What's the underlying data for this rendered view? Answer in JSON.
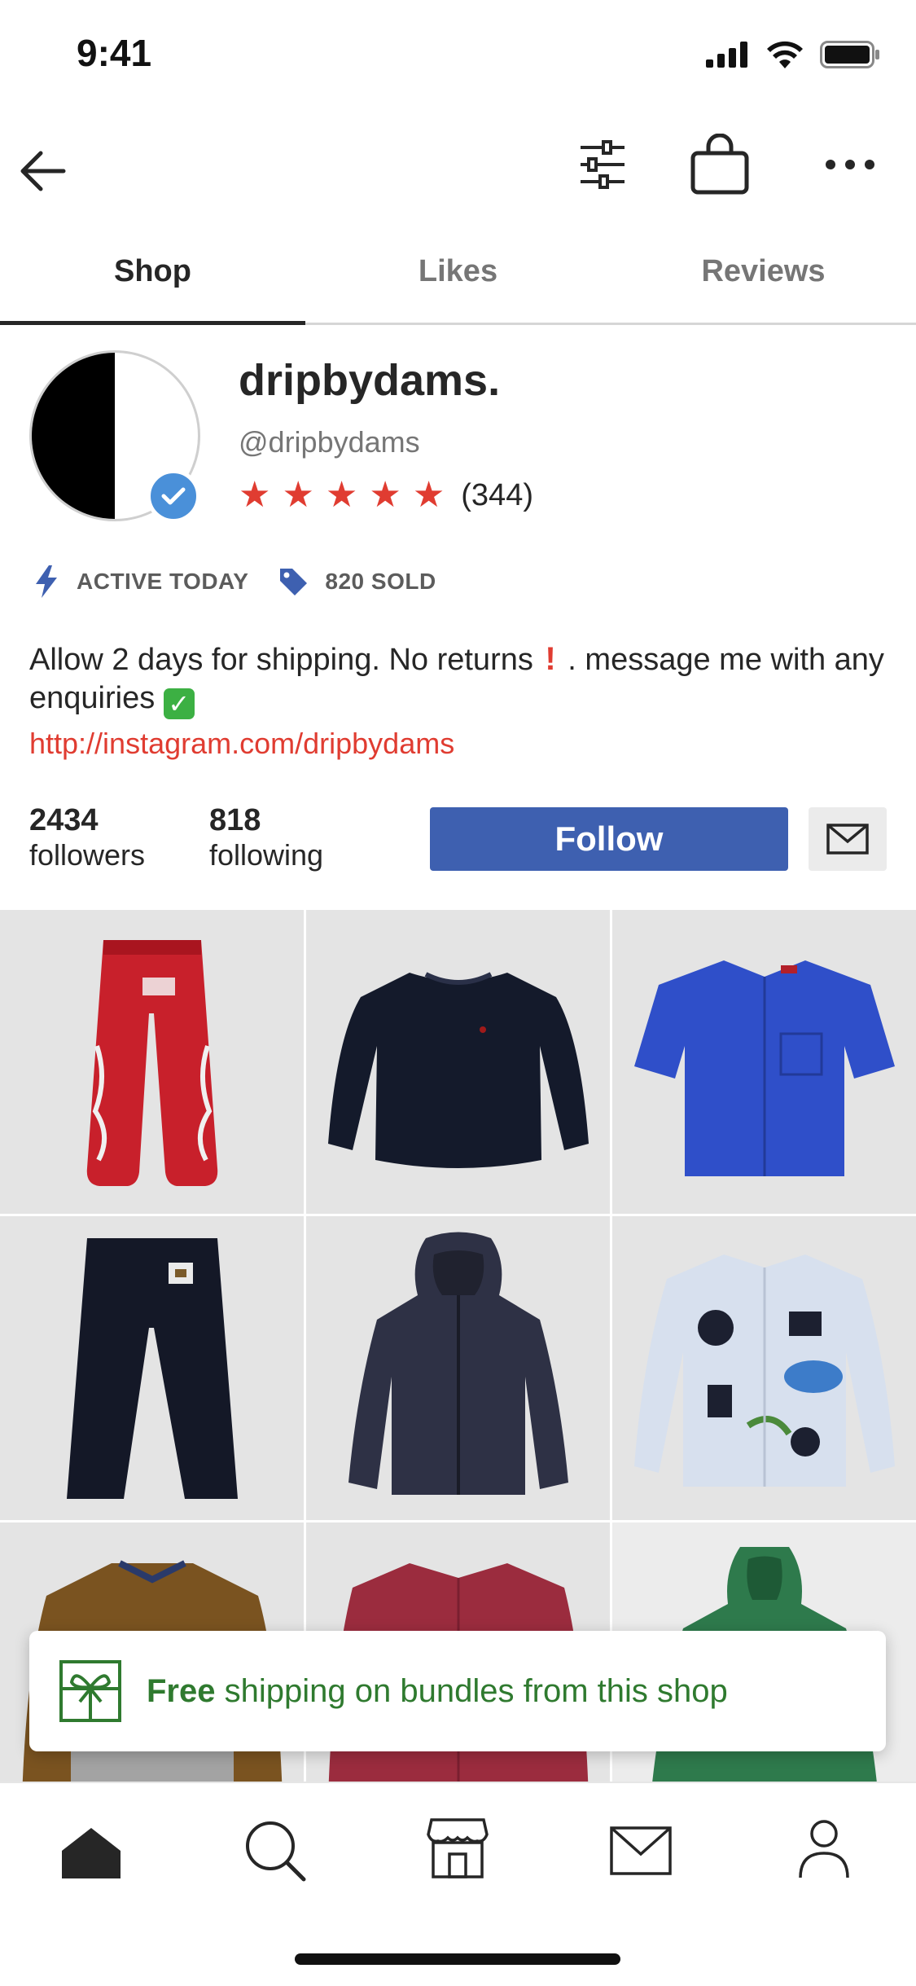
{
  "status_bar": {
    "time": "9:41"
  },
  "tabs": [
    {
      "label": "Shop",
      "active": true
    },
    {
      "label": "Likes",
      "active": false
    },
    {
      "label": "Reviews",
      "active": false
    }
  ],
  "profile": {
    "name": "dripbydams.",
    "handle": "@dripbydams",
    "rating_stars": 5,
    "rating_count": "(344)",
    "verified": true
  },
  "badges": {
    "active": {
      "icon": "lightning-icon",
      "label": "ACTIVE TODAY"
    },
    "sold": {
      "icon": "tag-icon",
      "label": "820 SOLD"
    }
  },
  "bio": {
    "text_part1": "Allow 2 days for shipping. No returns",
    "text_part2": " . message me with any enquiries",
    "link": "http://instagram.com/dripbydams"
  },
  "stats": {
    "followers_count": "2434",
    "followers_label": "followers",
    "following_count": "818",
    "following_label": "following"
  },
  "actions": {
    "follow_label": "Follow"
  },
  "grid_items": [
    {
      "name": "red-sweatpants"
    },
    {
      "name": "navy-sweatshirt"
    },
    {
      "name": "blue-short-sleeve-shirt"
    },
    {
      "name": "black-cargo-pants"
    },
    {
      "name": "navy-windbreaker-jacket"
    },
    {
      "name": "printed-button-shirt"
    },
    {
      "name": "brown-fleece-pullover"
    },
    {
      "name": "maroon-overshirt"
    },
    {
      "name": "green-puffer-jacket"
    }
  ],
  "banner": {
    "bold": "Free",
    "text": " shipping on bundles from this shop"
  },
  "colors": {
    "accent_red": "#e03c31",
    "follow_blue": "#3e60b0",
    "banner_green": "#2f7a2f",
    "verified_blue": "#4a90d9"
  }
}
